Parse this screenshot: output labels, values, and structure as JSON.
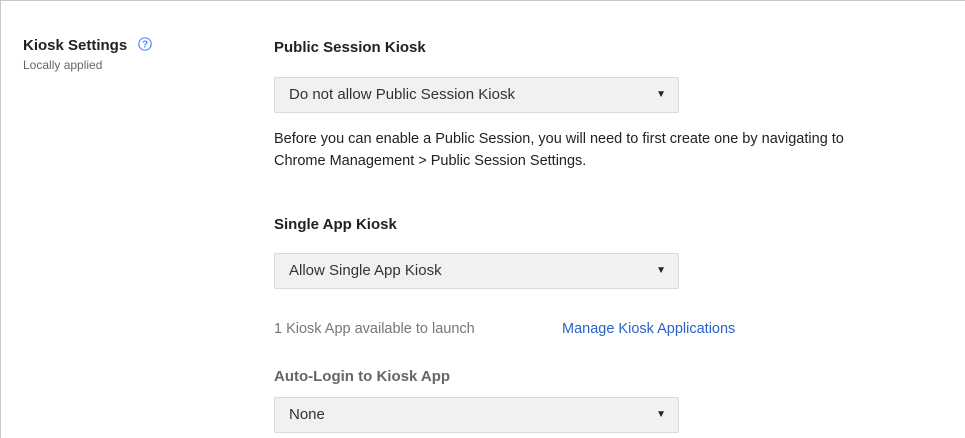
{
  "setting": {
    "title": "Kiosk Settings",
    "subtitle": "Locally applied",
    "help_icon": "help-circle-icon"
  },
  "public_session": {
    "label": "Public Session Kiosk",
    "selected": "Do not allow Public Session Kiosk",
    "description_line1": "Before you can enable a Public Session, you will need to first create one by navigating to",
    "description_line2": "Chrome Management > Public Session Settings."
  },
  "single_app": {
    "label": "Single App Kiosk",
    "selected": "Allow Single App Kiosk",
    "available_text": "1 Kiosk App available to launch",
    "manage_link": "Manage Kiosk Applications"
  },
  "auto_login": {
    "label": "Auto-Login to Kiosk App",
    "selected": "None"
  },
  "caret_glyph": "▼",
  "colors": {
    "link": "#2a62c9",
    "help_icon": "#4a8af4",
    "select_bg": "#f1f1f1"
  }
}
